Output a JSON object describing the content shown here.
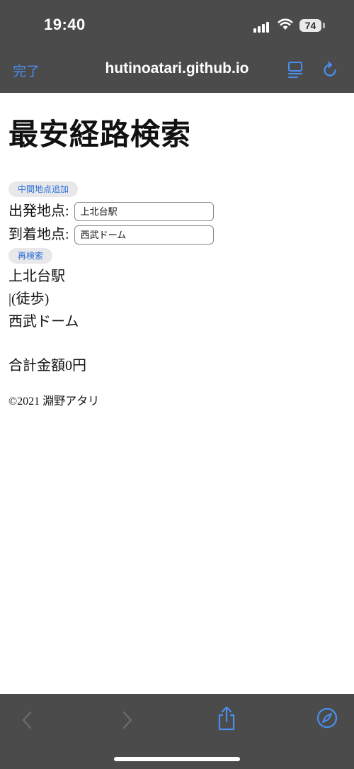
{
  "status_bar": {
    "time": "19:40",
    "battery": "74"
  },
  "browser": {
    "done_label": "完了",
    "url": "hutinoatari.github.io",
    "icons": {
      "reader": "reader-view-icon",
      "reload": "reload-icon",
      "back": "chevron-left-icon",
      "forward": "chevron-right-icon",
      "share": "share-icon",
      "compass": "compass-icon"
    },
    "accent_color": "#4a8ff0"
  },
  "page": {
    "title": "最安経路検索",
    "add_waypoint_label": "中間地点追加",
    "departure_label": "出発地点:",
    "departure_value": "上北台駅",
    "arrival_label": "到着地点:",
    "arrival_value": "西武ドーム",
    "research_label": "再検索",
    "route": [
      "上北台駅",
      "|(徒歩)",
      "西武ドーム"
    ],
    "total": "合計金額0円",
    "copyright": "©2021 淵野アタリ"
  }
}
